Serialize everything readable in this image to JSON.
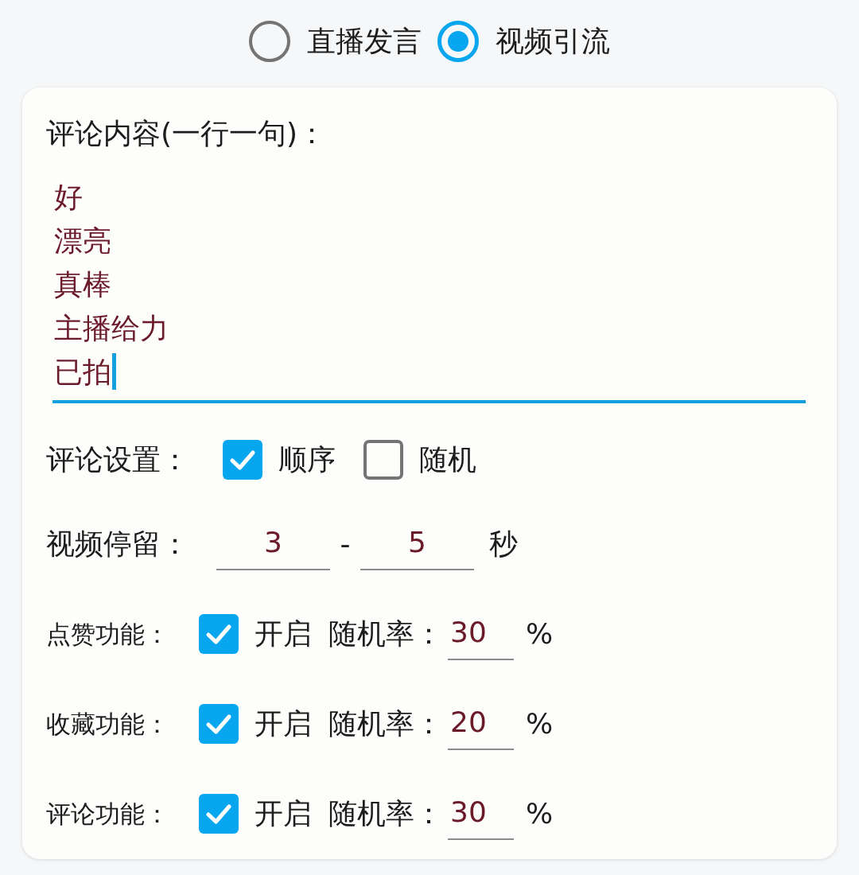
{
  "mode_options": [
    {
      "label": "直播发言",
      "selected": false
    },
    {
      "label": "视频引流",
      "selected": true
    }
  ],
  "comment_content": {
    "label": "评论内容(一行一句)：",
    "lines": [
      "好",
      "漂亮",
      "真棒",
      "主播给力",
      "已拍"
    ],
    "focused": true
  },
  "comment_settings": {
    "label": "评论设置：",
    "options": [
      {
        "label": "顺序",
        "checked": true
      },
      {
        "label": "随机",
        "checked": false
      }
    ]
  },
  "video_stay": {
    "label": "视频停留：",
    "min": "3",
    "separator": "-",
    "max": "5",
    "unit": "秒"
  },
  "features": [
    {
      "label": "点赞功能：",
      "checked": true,
      "enable_label": "开启",
      "rate_label": "随机率：",
      "rate": "30",
      "unit": "%"
    },
    {
      "label": "收藏功能：",
      "checked": true,
      "enable_label": "开启",
      "rate_label": "随机率：",
      "rate": "20",
      "unit": "%"
    },
    {
      "label": "评论功能：",
      "checked": true,
      "enable_label": "开启",
      "rate_label": "随机率：",
      "rate": "30",
      "unit": "%"
    }
  ]
}
